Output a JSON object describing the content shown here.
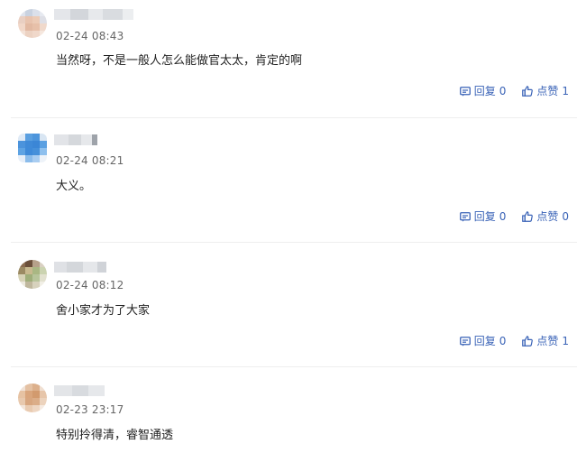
{
  "comments": [
    {
      "timestamp": "02-24 08:43",
      "text": "当然呀，不是一般人怎么能做官太太，肯定的啊",
      "reply_label": "回复",
      "reply_count": "0",
      "like_label": "点赞",
      "like_count": "1"
    },
    {
      "timestamp": "02-24 08:21",
      "text": "大义。",
      "reply_label": "回复",
      "reply_count": "0",
      "like_label": "点赞",
      "like_count": "0"
    },
    {
      "timestamp": "02-24 08:12",
      "text": "舍小家才为了大家",
      "reply_label": "回复",
      "reply_count": "0",
      "like_label": "点赞",
      "like_count": "1"
    },
    {
      "timestamp": "02-23 23:17",
      "text": "特别拎得清，睿智通透"
    }
  ],
  "icons": {
    "reply": "reply-icon",
    "like": "thumbs-up-icon"
  },
  "colors": {
    "action": "#3a63b7",
    "timestamp": "#666666",
    "divider": "#eeeeee"
  }
}
